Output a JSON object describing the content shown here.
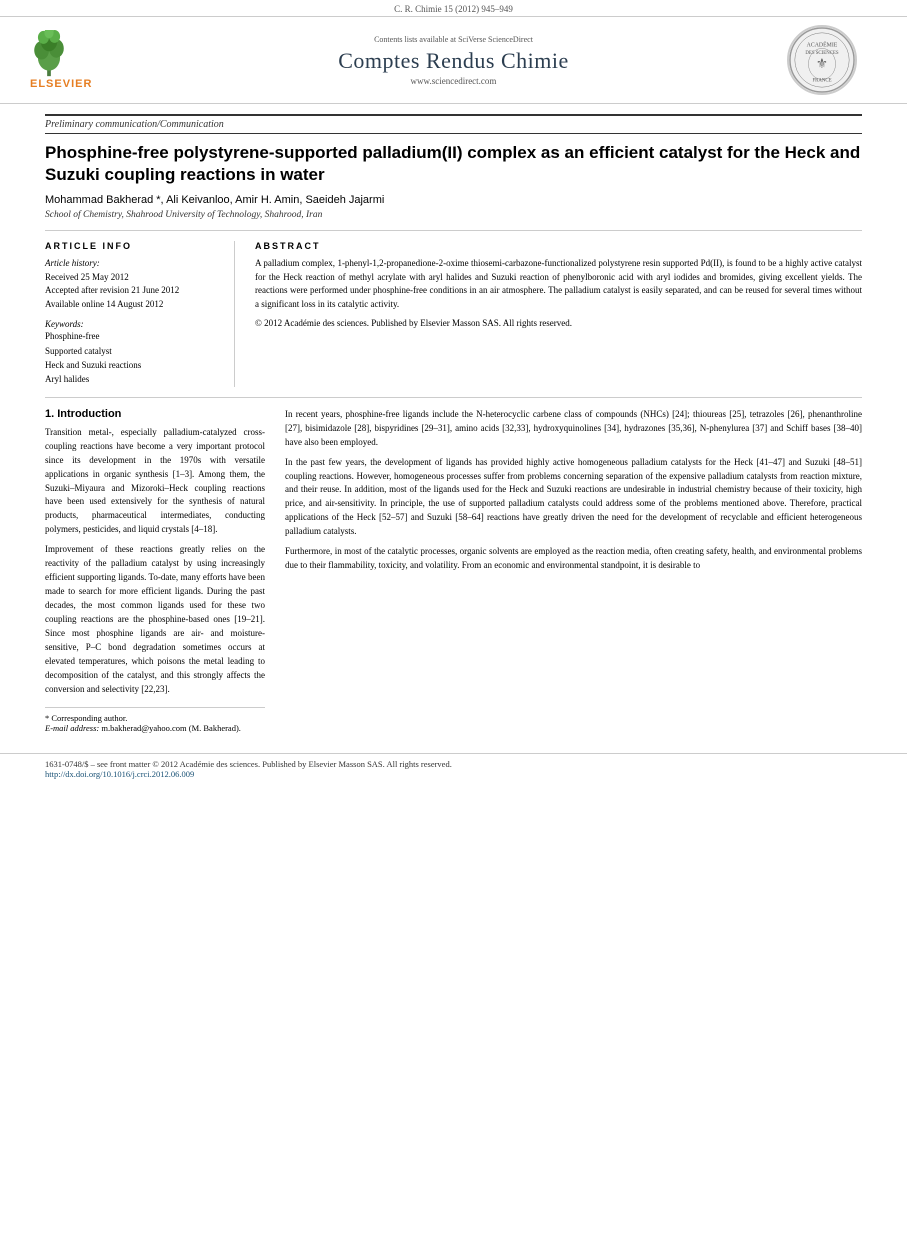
{
  "topBar": {
    "citation": "C. R. Chimie 15 (2012) 945–949"
  },
  "journalHeader": {
    "sciverse": "Contents lists available at SciVerse ScienceDirect",
    "journalTitle": "Comptes Rendus Chimie",
    "url": "www.sciencedirect.com",
    "elsevier": "ELSEVIER"
  },
  "articleType": "Preliminary communication/Communication",
  "articleTitle": "Phosphine-free polystyrene-supported palladium(II) complex as an efficient catalyst for the Heck and Suzuki coupling reactions in water",
  "authors": "Mohammad Bakherad *, Ali Keivanloo, Amir H. Amin, Saeideh Jajarmi",
  "affiliation": "School of Chemistry, Shahrood University of Technology, Shahrood, Iran",
  "articleInfo": {
    "heading": "ARTICLE INFO",
    "historyLabel": "Article history:",
    "received": "Received 25 May 2012",
    "accepted": "Accepted after revision 21 June 2012",
    "available": "Available online 14 August 2012",
    "keywordsLabel": "Keywords:",
    "keywords": [
      "Phosphine-free",
      "Supported catalyst",
      "Heck and Suzuki reactions",
      "Aryl halides"
    ]
  },
  "abstract": {
    "heading": "ABSTRACT",
    "text": "A palladium complex, 1-phenyl-1,2-propanedione-2-oxime thiosemi-carbazone-functionalized polystyrene resin supported Pd(II), is found to be a highly active catalyst for the Heck reaction of methyl acrylate with aryl halides and Suzuki reaction of phenylboronic acid with aryl iodides and bromides, giving excellent yields. The reactions were performed under phosphine-free conditions in an air atmosphere. The palladium catalyst is easily separated, and can be reused for several times without a significant loss in its catalytic activity.",
    "copyright": "© 2012 Académie des sciences. Published by Elsevier Masson SAS. All rights reserved."
  },
  "introduction": {
    "heading": "1. Introduction",
    "paragraphs": [
      "Transition metal-, especially palladium-catalyzed cross-coupling reactions have become a very important protocol since its development in the 1970s with versatile applications in organic synthesis [1–3]. Among them, the Suzuki–Miyaura and Mizoroki–Heck coupling reactions have been used extensively for the synthesis of natural products, pharmaceutical intermediates, conducting polymers, pesticides, and liquid crystals [4–18].",
      "Improvement of these reactions greatly relies on the reactivity of the palladium catalyst by using increasingly efficient supporting ligands. To-date, many efforts have been made to search for more efficient ligands. During the past decades, the most common ligands used for these two coupling reactions are the phosphine-based ones [19–21]. Since most phosphine ligands are air- and moisture-sensitive, P–C bond degradation sometimes occurs at elevated temperatures, which poisons the metal leading to decomposition of the catalyst, and this strongly affects the conversion and selectivity [22,23]."
    ]
  },
  "rightColumn": {
    "paragraphs": [
      "In recent years, phosphine-free ligands include the N-heterocyclic carbene class of compounds (NHCs) [24]; thioureas [25], tetrazoles [26], phenanthroline [27], bisimidazole [28], bispyridines [29–31], amino acids [32,33], hydroxyquinolines [34], hydrazones [35,36], N-phenylurea [37] and Schiff bases [38–40] have also been employed.",
      "In the past few years, the development of ligands has provided highly active homogeneous palladium catalysts for the Heck [41–47] and Suzuki [48–51] coupling reactions. However, homogeneous processes suffer from problems concerning separation of the expensive palladium catalysts from reaction mixture, and their reuse. In addition, most of the ligands used for the Heck and Suzuki reactions are undesirable in industrial chemistry because of their toxicity, high price, and air-sensitivity. In principle, the use of supported palladium catalysts could address some of the problems mentioned above. Therefore, practical applications of the Heck [52–57] and Suzuki [58–64] reactions have greatly driven the need for the development of recyclable and efficient heterogeneous palladium catalysts.",
      "Furthermore, in most of the catalytic processes, organic solvents are employed as the reaction media, often creating safety, health, and environmental problems due to their flammability, toxicity, and volatility. From an economic and environmental standpoint, it is desirable to"
    ]
  },
  "footnote": {
    "correspondingLabel": "* Corresponding author.",
    "emailLabel": "E-mail address:",
    "email": "m.bakherad@yahoo.com",
    "emailSuffix": "(M. Bakherad)."
  },
  "bottomBar": {
    "issn": "1631-0748/$ – see front matter © 2012 Académie des sciences. Published by Elsevier Masson SAS. All rights reserved.",
    "doi": "http://dx.doi.org/10.1016/j.crci.2012.06.009"
  }
}
